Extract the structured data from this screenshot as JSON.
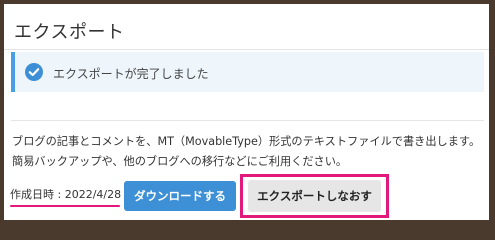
{
  "page": {
    "title": "エクスポート"
  },
  "alert": {
    "message": "エクスポートが完了しました",
    "icon": "check-circle-icon",
    "accent_color": "#4a9ee4"
  },
  "description": {
    "line1": "ブログの記事とコメントを、MT（MovableType）形式のテキストファイルで書き出します。",
    "line2": "簡易バックアップや、他のブログへの移行などにご利用ください。"
  },
  "footer": {
    "created_label": "作成日時 : 2022/4/28",
    "download_button": "ダウンロードする",
    "reexport_button": "エクスポートしなおす"
  },
  "colors": {
    "primary_button": "#3d8fd6",
    "highlight": "#e2197d"
  }
}
